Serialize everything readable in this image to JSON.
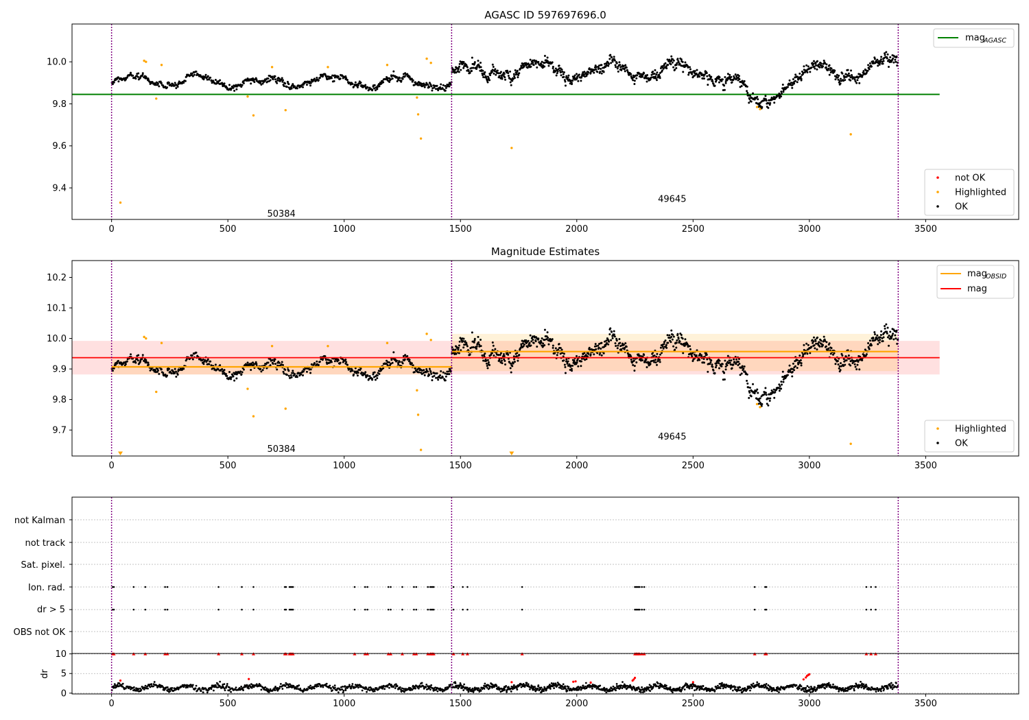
{
  "chart_data": [
    {
      "type": "scatter",
      "title": "AGASC ID 597697696.0",
      "xlim": [
        -170,
        3900
      ],
      "ylim": [
        9.25,
        10.18
      ],
      "xticks": [
        0,
        500,
        1000,
        1500,
        2000,
        2500,
        3000,
        3500
      ],
      "yticks": [
        9.4,
        9.6,
        9.8,
        10.0
      ],
      "obs_boundaries": [
        0,
        1462,
        3382
      ],
      "obsid_labels": [
        {
          "text": "50384",
          "x": 730,
          "y": 9.28
        },
        {
          "text": "49645",
          "x": 2410,
          "y": 9.35
        }
      ],
      "mag_agasc": {
        "value": 9.845,
        "x_range": [
          -170,
          3560
        ],
        "color": "#008000"
      },
      "ok_series": {
        "name": "OK",
        "color": "#000000",
        "segments": [
          {
            "x_range": [
              0,
              1462
            ],
            "mean": 9.905,
            "scatter": 0.025,
            "count": 600
          },
          {
            "x_range": [
              1462,
              3382
            ],
            "mean": 9.96,
            "scatter": 0.04,
            "count": 1000
          }
        ]
      },
      "highlighted": {
        "name": "Highlighted",
        "color": "#ffa500",
        "points": [
          [
            38,
            9.33
          ],
          [
            140,
            10.005
          ],
          [
            148,
            10.0
          ],
          [
            192,
            9.825
          ],
          [
            215,
            9.985
          ],
          [
            585,
            9.835
          ],
          [
            610,
            9.745
          ],
          [
            690,
            9.975
          ],
          [
            748,
            9.77
          ],
          [
            930,
            9.975
          ],
          [
            1185,
            9.985
          ],
          [
            1313,
            9.83
          ],
          [
            1318,
            9.75
          ],
          [
            1330,
            9.635
          ],
          [
            1355,
            10.015
          ],
          [
            1373,
            9.995
          ],
          [
            1720,
            9.59
          ],
          [
            2775,
            9.785
          ],
          [
            2788,
            9.775
          ],
          [
            3178,
            9.655
          ]
        ]
      },
      "not_ok": {
        "name": "not OK",
        "color": "#ff0000",
        "points": []
      },
      "legend_lines": [
        {
          "label": "mag",
          "sub": "AGASC",
          "color": "#008000"
        }
      ],
      "legend_points": [
        {
          "label": "not OK",
          "color": "#ff0000"
        },
        {
          "label": "Highlighted",
          "color": "#ffa500"
        },
        {
          "label": "OK",
          "color": "#000000"
        }
      ]
    },
    {
      "type": "scatter",
      "title": "Magnitude Estimates",
      "xlim": [
        -170,
        3900
      ],
      "ylim": [
        9.615,
        10.255
      ],
      "xticks": [
        0,
        500,
        1000,
        1500,
        2000,
        2500,
        3000,
        3500
      ],
      "yticks": [
        9.7,
        9.8,
        9.9,
        10.0,
        10.1,
        10.2
      ],
      "obs_boundaries": [
        0,
        1462,
        3382
      ],
      "obsid_labels": [
        {
          "text": "50384",
          "x": 730,
          "y": 9.64
        },
        {
          "text": "49645",
          "x": 2410,
          "y": 9.68
        }
      ],
      "mag": {
        "value": 9.937,
        "band": [
          9.882,
          9.992
        ],
        "x_range": [
          -170,
          3560
        ],
        "color": "#ff0000"
      },
      "mag_obsid": [
        {
          "x_range": [
            0,
            1462
          ],
          "value": 9.907,
          "band": [
            9.882,
            9.932
          ]
        },
        {
          "x_range": [
            1462,
            3382
          ],
          "value": 9.957,
          "band": [
            9.893,
            10.015
          ]
        }
      ],
      "mag_obsid_color": "#ffa500",
      "highlighted": {
        "name": "Highlighted",
        "color": "#ffa500",
        "points": [
          [
            140,
            10.005
          ],
          [
            148,
            10.0
          ],
          [
            192,
            9.825
          ],
          [
            215,
            9.985
          ],
          [
            585,
            9.835
          ],
          [
            610,
            9.745
          ],
          [
            690,
            9.975
          ],
          [
            748,
            9.77
          ],
          [
            930,
            9.975
          ],
          [
            1185,
            9.985
          ],
          [
            1313,
            9.83
          ],
          [
            1318,
            9.75
          ],
          [
            1330,
            9.635
          ],
          [
            1355,
            10.015
          ],
          [
            1373,
            9.995
          ],
          [
            2775,
            9.785
          ],
          [
            2788,
            9.775
          ],
          [
            3178,
            9.655
          ]
        ]
      },
      "down_markers": [
        [
          38,
          9.623
        ],
        [
          1720,
          9.623
        ]
      ],
      "legend_lines": [
        {
          "label": "mag",
          "sub": "OBSID",
          "color": "#ffa500"
        },
        {
          "label": "mag",
          "sub": "",
          "color": "#ff0000"
        }
      ],
      "legend_points": [
        {
          "label": "Highlighted",
          "color": "#ffa500"
        },
        {
          "label": "OK",
          "color": "#000000"
        }
      ]
    },
    {
      "type": "scatter",
      "title": "",
      "xlim": [
        -170,
        3900
      ],
      "categories": [
        "not Kalman",
        "not track",
        "Sat. pixel.",
        "Ion. rad.",
        "dr > 5",
        "OBS not OK"
      ],
      "flag_points": {
        "Ion. rad.": [
          5,
          10,
          95,
          145,
          230,
          240,
          460,
          560,
          610,
          745,
          750,
          765,
          770,
          775,
          780,
          1045,
          1090,
          1100,
          1190,
          1200,
          1250,
          1300,
          1310,
          1360,
          1370,
          1375,
          1380,
          1385,
          1470,
          1510,
          1530,
          1765,
          2250,
          2255,
          2260,
          2265,
          2270,
          2280,
          2290,
          2765,
          2810,
          2815,
          3245,
          3265,
          3285
        ],
        "dr > 5": [
          5,
          10,
          95,
          145,
          230,
          240,
          460,
          560,
          610,
          745,
          750,
          765,
          770,
          775,
          780,
          1045,
          1090,
          1100,
          1190,
          1200,
          1250,
          1300,
          1310,
          1360,
          1370,
          1375,
          1380,
          1385,
          1470,
          1510,
          1530,
          1765,
          2250,
          2255,
          2260,
          2265,
          2270,
          2280,
          2290,
          2765,
          2810,
          2815,
          3245,
          3265,
          3285
        ]
      },
      "obs_boundaries": [
        0,
        1462,
        3382
      ]
    },
    {
      "type": "scatter",
      "title": "",
      "ylabel": "dr",
      "xlim": [
        -170,
        3900
      ],
      "ylim": [
        -0.2,
        10.1
      ],
      "xticks": [
        0,
        500,
        1000,
        1500,
        2000,
        2500,
        3000,
        3500
      ],
      "yticks": [
        0,
        5,
        10
      ],
      "obs_boundaries": [
        0,
        1462,
        3382
      ],
      "dr_mean": 1.4,
      "red_clipped_x": [
        5,
        10,
        95,
        145,
        230,
        240,
        460,
        560,
        610,
        745,
        750,
        765,
        770,
        775,
        780,
        1045,
        1090,
        1100,
        1190,
        1200,
        1250,
        1300,
        1310,
        1360,
        1370,
        1375,
        1380,
        1385,
        1470,
        1510,
        1530,
        1765,
        2250,
        2255,
        2260,
        2265,
        2270,
        2280,
        2290,
        2765,
        2810,
        2815,
        3245,
        3265,
        3285
      ],
      "red_points": [
        [
          38,
          3.2
        ],
        [
          590,
          3.6
        ],
        [
          1720,
          2.8
        ],
        [
          1985,
          2.9
        ],
        [
          1995,
          3.0
        ],
        [
          2060,
          2.7
        ],
        [
          2240,
          3.2
        ],
        [
          2245,
          3.5
        ],
        [
          2250,
          3.9
        ],
        [
          2500,
          2.8
        ],
        [
          2975,
          3.5
        ],
        [
          2985,
          4.0
        ],
        [
          2990,
          4.4
        ],
        [
          2995,
          4.6
        ],
        [
          3000,
          4.8
        ]
      ]
    }
  ]
}
